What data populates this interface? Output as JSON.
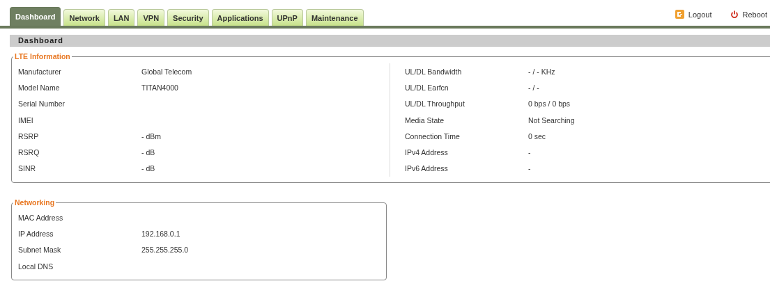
{
  "tabs": [
    {
      "label": "Dashboard",
      "selected": true
    },
    {
      "label": "Network",
      "selected": false
    },
    {
      "label": "LAN",
      "selected": false
    },
    {
      "label": "VPN",
      "selected": false
    },
    {
      "label": "Security",
      "selected": false
    },
    {
      "label": "Applications",
      "selected": false
    },
    {
      "label": "UPnP",
      "selected": false
    },
    {
      "label": "Maintenance",
      "selected": false
    }
  ],
  "actions": [
    {
      "kind": "logout",
      "label": "Logout"
    },
    {
      "kind": "reboot",
      "label": "Reboot"
    }
  ],
  "page_title": "Dashboard",
  "lte_information": {
    "title": "LTE Information",
    "left": [
      {
        "label": "Manufacturer",
        "value": "Global Telecom"
      },
      {
        "label": "Model Name",
        "value": "TITAN4000"
      },
      {
        "label": "Serial Number"
      },
      {
        "label": "IMEI"
      },
      {
        "label": "RSRP",
        "value": "- dBm"
      },
      {
        "label": "RSRQ",
        "value": "- dB"
      },
      {
        "label": "SINR",
        "value": "- dB"
      }
    ],
    "right": [
      {
        "label": "UL/DL Bandwidth",
        "value": "- / - KHz"
      },
      {
        "label": "UL/DL Earfcn",
        "value": "- / -"
      },
      {
        "label": "UL/DL Throughput",
        "value": "0 bps / 0 bps"
      },
      {
        "label": "Media State",
        "value": "Not Searching"
      },
      {
        "label": "Connection Time",
        "value": "0 sec"
      },
      {
        "label": "IPv4 Address",
        "value": "-"
      },
      {
        "label": "IPv6 Address",
        "value": "-"
      }
    ]
  },
  "networking": {
    "title": "Networking",
    "rows": [
      {
        "label": "MAC Address"
      },
      {
        "label": "IP Address",
        "value": "192.168.0.1"
      },
      {
        "label": "Subnet Mask",
        "value": "255.255.255.0"
      },
      {
        "label": "Local DNS"
      }
    ]
  }
}
